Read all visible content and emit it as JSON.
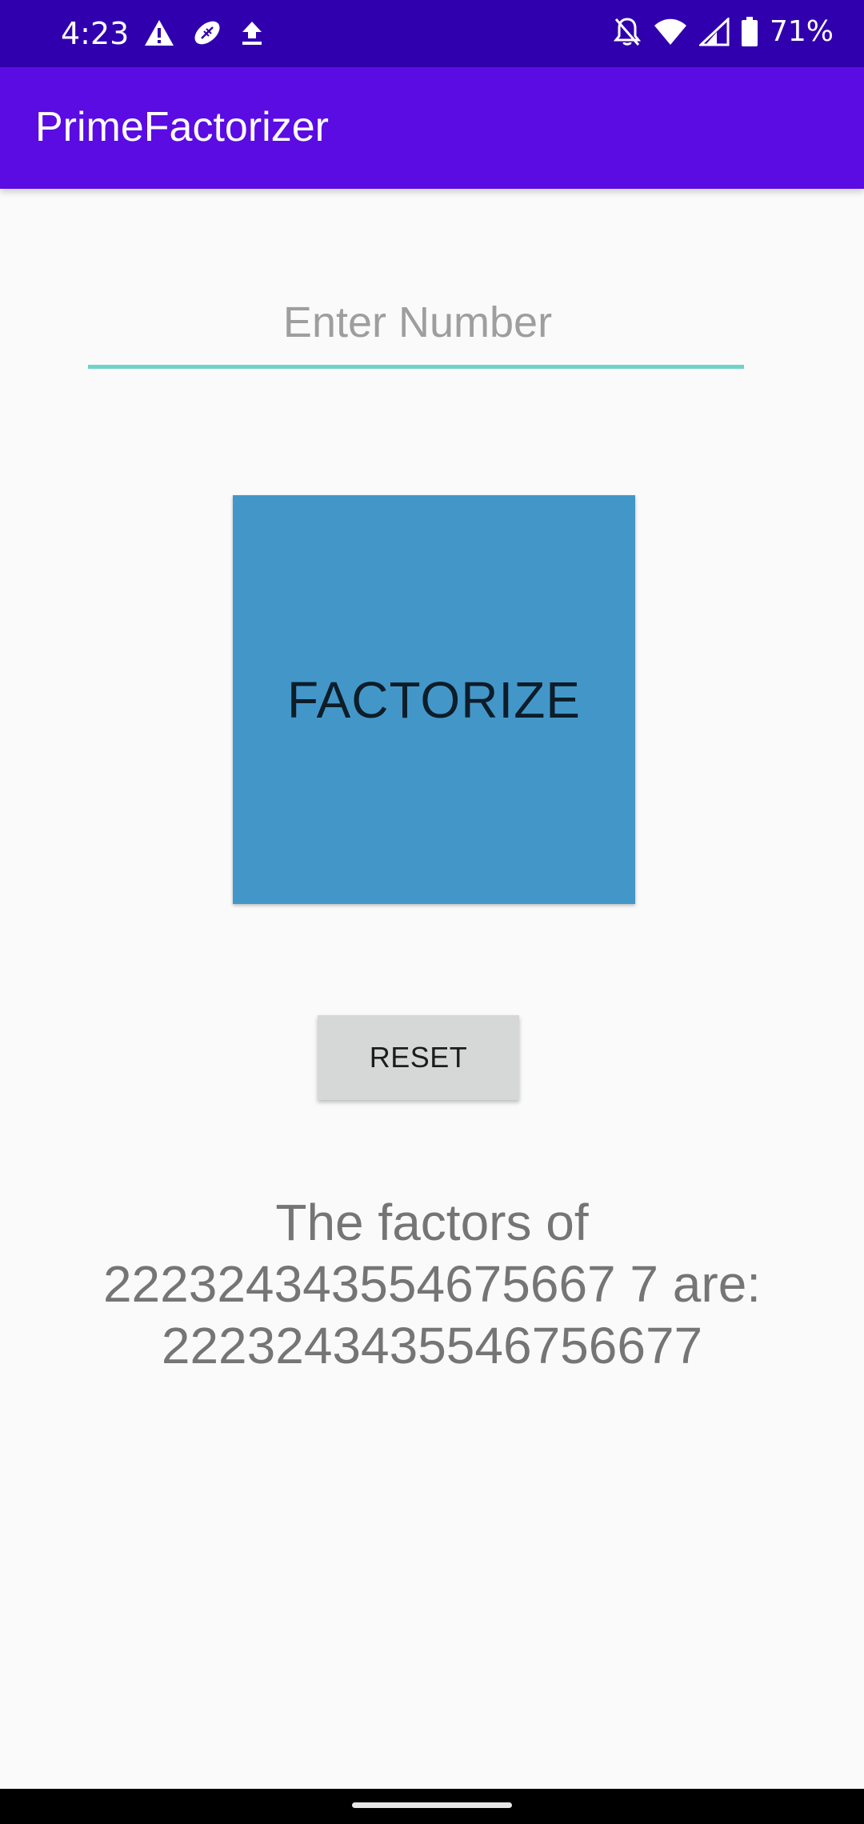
{
  "status_bar": {
    "time": "4:23",
    "left_icons": [
      "warning-icon",
      "football-icon",
      "upload-icon"
    ],
    "right_icons": [
      "notifications-off-icon",
      "wifi-icon",
      "signal-icon",
      "battery-icon"
    ],
    "battery": "71%"
  },
  "app_bar": {
    "title": "PrimeFactorizer"
  },
  "input": {
    "value": "",
    "placeholder": "Enter Number"
  },
  "buttons": {
    "factorize_label": "FACTORIZE",
    "reset_label": "RESET"
  },
  "result": {
    "line1": "The factors of",
    "line2": "222324343554675667 7 are:",
    "line3": "2223243435546756677"
  },
  "colors": {
    "status_bar": "#3100ae",
    "app_bar": "#5b0ce3",
    "underline": "#6fd3c7",
    "factorize_bg": "#4397c8",
    "reset_bg": "#d6d7d7",
    "result_text": "#757575"
  }
}
